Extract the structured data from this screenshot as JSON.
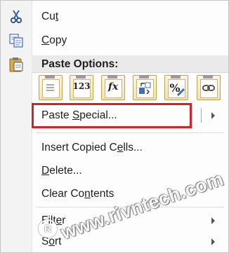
{
  "menu": {
    "cut": {
      "pre": "Cu",
      "acc": "t",
      "post": ""
    },
    "copy": {
      "pre": "",
      "acc": "C",
      "post": "opy"
    },
    "paste_options_header": "Paste Options:",
    "paste_buttons": [
      {
        "name": "paste-icon",
        "glyph": ""
      },
      {
        "name": "paste-values-icon",
        "glyph": "123"
      },
      {
        "name": "paste-formulas-icon",
        "glyph": "fx"
      },
      {
        "name": "paste-transpose-icon",
        "glyph": ""
      },
      {
        "name": "paste-formatting-icon",
        "glyph": "%"
      },
      {
        "name": "paste-link-icon",
        "glyph": ""
      }
    ],
    "paste_special": {
      "pre": "Paste ",
      "acc": "S",
      "post": "pecial..."
    },
    "insert_copied_cells": {
      "pre": "Insert Copied C",
      "acc": "e",
      "post": "lls..."
    },
    "delete": {
      "pre": "",
      "acc": "D",
      "post": "elete..."
    },
    "clear_contents": {
      "pre": "Clear Co",
      "acc": "n",
      "post": "tents"
    },
    "filter": {
      "pre": "Filt",
      "acc": "e",
      "post": "r"
    },
    "sort": {
      "pre": "S",
      "acc": "o",
      "post": "rt"
    }
  },
  "watermark": {
    "symbol": "R",
    "text": "www.rivntech.com"
  },
  "colors": {
    "highlight_border": "#d1232a",
    "paste_button_fill": "#f5e3a8"
  }
}
